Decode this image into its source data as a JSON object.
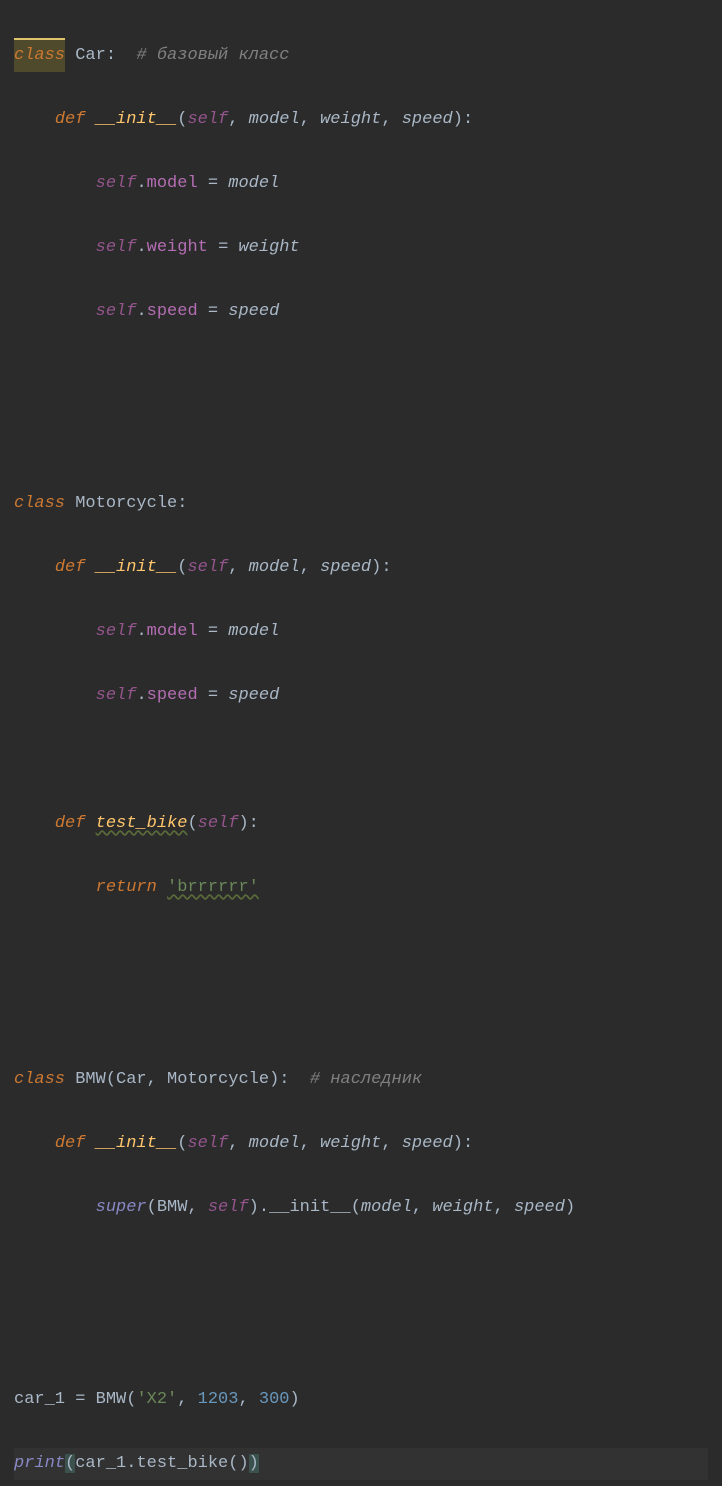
{
  "tokens": {
    "class_kw": "class",
    "def_kw": "def",
    "return_kw": "return",
    "self_kw": "self",
    "super_kw": "super",
    "print_kw": "print",
    "Car": "Car",
    "Motorcycle": "Motorcycle",
    "BMW": "BMW",
    "init": "__init__",
    "model": "model",
    "weight": "weight",
    "speed": "speed",
    "test_bike": "test_bike",
    "comment1": "# базовый класс",
    "comment2": "# наследник",
    "str_brr": "'brrrrrr'",
    "car_1": "car_1",
    "str_X2": "'X2'",
    "num1": "1203",
    "num2": "300",
    "col": ":",
    "comma": ",",
    "lpar": "(",
    "rpar": ")",
    "dot": ".",
    "eq": "=",
    "space": " "
  }
}
